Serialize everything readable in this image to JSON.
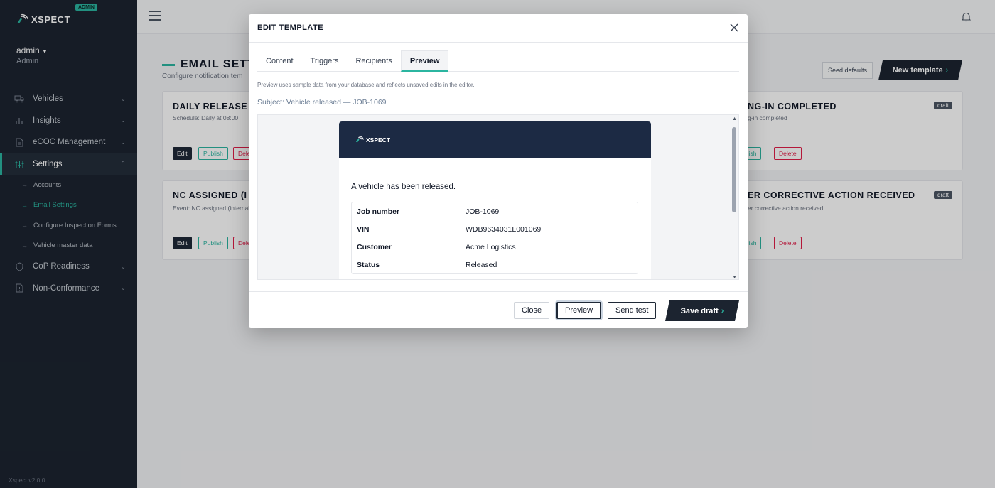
{
  "brand": {
    "name": "XSPECT",
    "badge": "ADMIN",
    "accent": "#2bb5a0",
    "dark": "#1c2430"
  },
  "user": {
    "name": "admin",
    "role": "Admin"
  },
  "sidebar": {
    "items": [
      {
        "label": "Vehicles",
        "icon": "truck-icon"
      },
      {
        "label": "Insights",
        "icon": "bar-chart-icon"
      },
      {
        "label": "eCOC Management",
        "icon": "document-icon"
      },
      {
        "label": "Settings",
        "icon": "sliders-icon"
      },
      {
        "label": "CoP Readiness",
        "icon": "shield-icon"
      },
      {
        "label": "Non-Conformance",
        "icon": "file-alert-icon"
      }
    ],
    "sub_items": [
      {
        "label": "Accounts"
      },
      {
        "label": "Email Settings"
      },
      {
        "label": "Configure Inspection Forms"
      },
      {
        "label": "Vehicle master data"
      }
    ],
    "version": "Xspect v2.0.0"
  },
  "page": {
    "title": "EMAIL SETT",
    "subtitle": "Configure notification tem",
    "seed_label": "Seed defaults",
    "new_label": "New template",
    "cards": [
      {
        "title": "DAILY RELEASE",
        "sub": "Schedule: Daily at 08:00",
        "edit": "Edit",
        "publish": "Publish",
        "delete": "Dele"
      },
      {
        "title": "NC ASSIGNED (I",
        "sub": "Event: NC assigned (internal",
        "edit": "Edit",
        "publish": "Publish",
        "delete": "Dele"
      },
      {
        "title": "NG-IN COMPLETED",
        "sub": "g-in completed",
        "publish": "blish",
        "delete": "Delete",
        "badge": "draft"
      },
      {
        "title": "ER CORRECTIVE ACTION RECEIVED",
        "sub": "er corrective action received",
        "publish": "blish",
        "delete": "Delete",
        "badge": "draft"
      }
    ]
  },
  "modal": {
    "title": "EDIT TEMPLATE",
    "tabs": [
      "Content",
      "Triggers",
      "Recipients",
      "Preview"
    ],
    "note": "Preview uses sample data from your database and reflects unsaved edits in the editor.",
    "subject": "Subject: Vehicle released — JOB-1069",
    "email": {
      "logo": "XSPECT",
      "message": "A vehicle has been released.",
      "rows": [
        {
          "k": "Job number",
          "v": "JOB-1069"
        },
        {
          "k": "VIN",
          "v": "WDB9634031L001069"
        },
        {
          "k": "Customer",
          "v": "Acme Logistics"
        },
        {
          "k": "Status",
          "v": "Released"
        }
      ]
    },
    "footer": {
      "close": "Close",
      "preview": "Preview",
      "send": "Send test",
      "save": "Save draft"
    }
  }
}
